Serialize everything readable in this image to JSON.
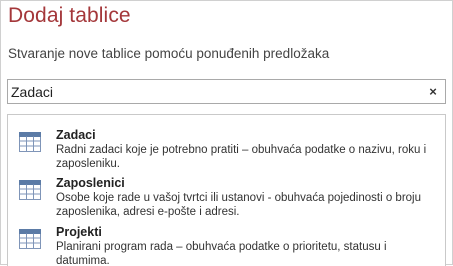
{
  "dialog": {
    "title": "Dodaj tablice",
    "subtitle": "Stvaranje nove tablice pomoću ponuđenih predložaka"
  },
  "search": {
    "value": "Zadaci",
    "clear_glyph": "×"
  },
  "templates": [
    {
      "title": "Zadaci",
      "description": "Radni zadaci koje je potrebno pratiti – obuhvaća podatke o nazivu, roku i zaposleniku.",
      "icon": "table-icon"
    },
    {
      "title": "Zaposlenici",
      "description": "Osobe koje rade u vašoj tvrtci ili ustanovi - obuhvaća pojedinosti o broju zaposlenika, adresi e-pošte i adresi.",
      "icon": "table-icon"
    },
    {
      "title": "Projekti",
      "description": "Planirani program rada – obuhvaća podatke o prioritetu, statusu i datumima.",
      "icon": "table-icon"
    }
  ],
  "colors": {
    "title": "#a4373a",
    "icon_header": "#5b7ba6",
    "icon_grid": "#7f95b8"
  }
}
